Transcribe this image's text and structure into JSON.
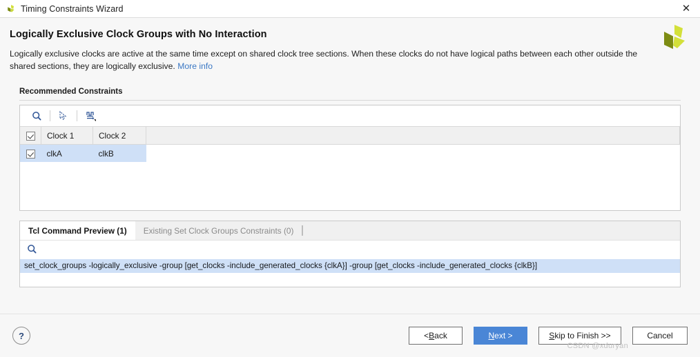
{
  "window": {
    "title": "Timing Constraints Wizard",
    "app_icon": "vivado-logo-icon",
    "close_label": "✕"
  },
  "header": {
    "page_title": "Logically Exclusive Clock Groups with No Interaction",
    "description": "Logically exclusive clocks are active at the same time except on shared clock tree sections. When these clocks do not have logical paths between each other outside the shared sections, they are logically exclusive.",
    "more_info_label": "More info",
    "brand_logo": "xilinx-logo-icon"
  },
  "constraints": {
    "section_label": "Recommended Constraints",
    "toolbar": [
      {
        "name": "search-icon",
        "title": "Search"
      },
      {
        "name": "select-all-icon",
        "title": "Select"
      },
      {
        "name": "waveform-icon",
        "title": "Clock Interaction"
      }
    ],
    "columns": [
      "Clock 1",
      "Clock 2"
    ],
    "header_checkbox_checked": true,
    "rows": [
      {
        "checked": true,
        "clock1": "clkA",
        "clock2": "clkB"
      }
    ]
  },
  "preview": {
    "tabs": [
      {
        "label": "Tcl Command Preview (1)",
        "active": true
      },
      {
        "label": "Existing Set Clock Groups Constraints (0)",
        "active": false
      }
    ],
    "search_icon": "search-icon",
    "commands": [
      "set_clock_groups -logically_exclusive -group [get_clocks -include_generated_clocks {clkA}] -group [get_clocks -include_generated_clocks {clkB}]"
    ]
  },
  "footer": {
    "help_label": "?",
    "buttons": [
      {
        "name": "back-button",
        "pre": "< ",
        "mnemonic": "B",
        "post": "ack",
        "primary": false
      },
      {
        "name": "next-button",
        "pre": "",
        "mnemonic": "N",
        "post": "ext >",
        "primary": true
      },
      {
        "name": "skip-button",
        "pre": "",
        "mnemonic": "S",
        "post": "kip to Finish >>",
        "primary": false
      },
      {
        "name": "cancel-button",
        "pre": "",
        "mnemonic": "",
        "post": "Cancel",
        "primary": false
      }
    ]
  },
  "watermark": "CSDN @xduryan",
  "colors": {
    "accent": "#4a86d6",
    "selection": "#cfe0f7",
    "link": "#3b78c4",
    "icon": "#2f5596",
    "brand_dark": "#7d8c13",
    "brand_light": "#d3e03a"
  }
}
